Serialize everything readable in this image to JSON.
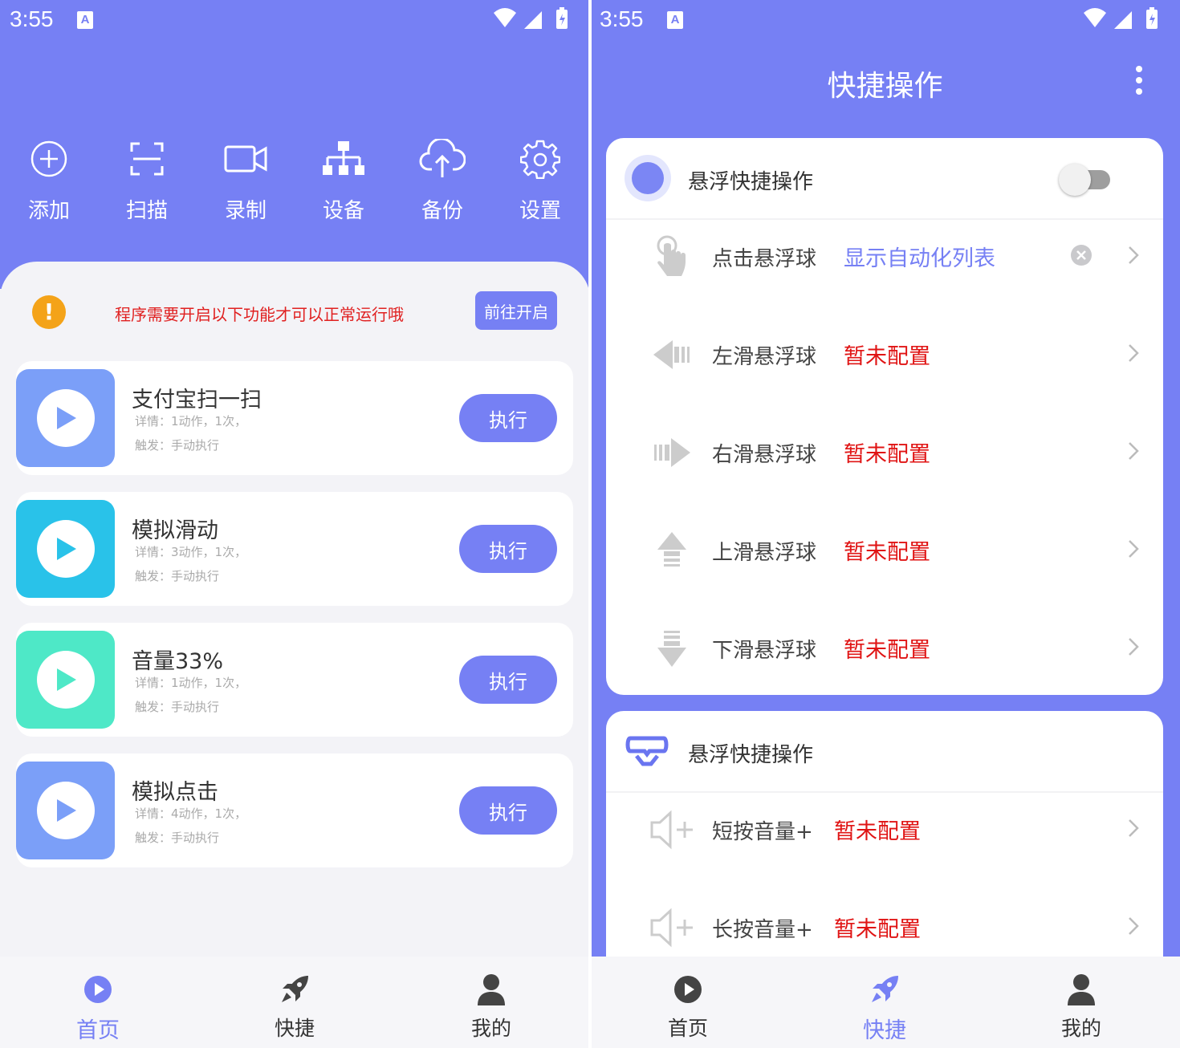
{
  "status_bar": {
    "time": "3:55",
    "notif_icon_letter": "A"
  },
  "home": {
    "toolbar": [
      {
        "label": "添加",
        "icon": "add-circle-icon"
      },
      {
        "label": "扫描",
        "icon": "scan-icon"
      },
      {
        "label": "录制",
        "icon": "video-icon"
      },
      {
        "label": "设备",
        "icon": "device-tree-icon"
      },
      {
        "label": "备份",
        "icon": "cloud-upload-icon"
      },
      {
        "label": "设置",
        "icon": "gear-icon"
      }
    ],
    "notice": {
      "message": "程序需要开启以下功能才可以正常运行哦",
      "button": "前往开启"
    },
    "tasks": [
      {
        "name": "支付宝扫一扫",
        "detail": "详情：1动作，1次，",
        "trigger": "触发：手动执行",
        "button": "执行",
        "color": "#7b9ff8"
      },
      {
        "name": "模拟滑动",
        "detail": "详情：3动作，1次，",
        "trigger": "触发：手动执行",
        "button": "执行",
        "color": "#29c2e9"
      },
      {
        "name": "音量33%",
        "detail": "详情：1动作，1次，",
        "trigger": "触发：手动执行",
        "button": "执行",
        "color": "#4ee8c7"
      },
      {
        "name": "模拟点击",
        "detail": "详情：4动作，1次，",
        "trigger": "触发：手动执行",
        "button": "执行",
        "color": "#7b9ff8"
      }
    ]
  },
  "nav": {
    "home": "首页",
    "quick": "快捷",
    "mine": "我的"
  },
  "quick": {
    "title": "快捷操作",
    "floating_section": {
      "title": "悬浮快捷操作",
      "toggle_on": false,
      "rows": [
        {
          "label": "点击悬浮球",
          "value": "显示自动化列表",
          "icon": "tap-hand-icon"
        },
        {
          "label": "左滑悬浮球",
          "value": "暂未配置",
          "icon": "swipe-left-icon"
        },
        {
          "label": "右滑悬浮球",
          "value": "暂未配置",
          "icon": "swipe-right-icon"
        },
        {
          "label": "上滑悬浮球",
          "value": "暂未配置",
          "icon": "swipe-up-icon"
        },
        {
          "label": "下滑悬浮球",
          "value": "暂未配置",
          "icon": "swipe-down-icon"
        }
      ]
    },
    "volume_section": {
      "title": "悬浮快捷操作",
      "rows": [
        {
          "label": "短按音量+",
          "value": "暂未配置",
          "icon": "volume-up-icon"
        },
        {
          "label": "长按音量+",
          "value": "暂未配置",
          "icon": "volume-up-icon"
        }
      ]
    }
  },
  "colors": {
    "accent": "#7680f4",
    "warn": "#f4a319",
    "error_text": "#e01414"
  }
}
